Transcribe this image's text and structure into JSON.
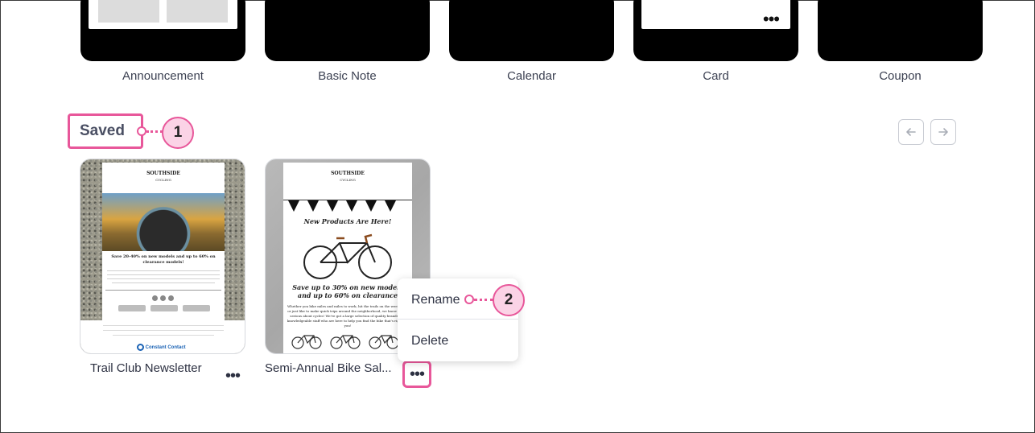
{
  "templates": [
    {
      "label": "Announcement"
    },
    {
      "label": "Basic Note"
    },
    {
      "label": "Calendar"
    },
    {
      "label": "Card"
    },
    {
      "label": "Coupon"
    }
  ],
  "saved_section": {
    "title": "Saved",
    "callout_1": "1",
    "prev_icon": "arrow-left-icon",
    "next_icon": "arrow-right-icon"
  },
  "saved_items": [
    {
      "name": "Trail Club Newsletter",
      "thumb": {
        "brand": "SOUTHSIDE",
        "brand_sub": "CYCLING",
        "headline": "Save 20-40% on new models and up to 60% on clearance models!",
        "logo": "Constant Contact"
      }
    },
    {
      "name": "Semi-Annual Bike Sal...",
      "thumb": {
        "brand": "SOUTHSIDE",
        "brand_sub": "CYCLING",
        "headline": "New Products Are Here!",
        "promo": "Save up to 30% on new models and up to 60% on clearance",
        "body": "Whether you bike miles and miles to work, hit the trails on the weekends, or just like to make quick trips around the neighborhood, we know you're serious about cycles! We've got a large selection of quality brands and knowledgeable staff who are here to help you find the bike that's right for you!"
      }
    }
  ],
  "more_glyph": "•••",
  "menu": {
    "rename": "Rename",
    "delete": "Delete",
    "callout_2": "2"
  },
  "colors": {
    "highlight": "#e8579a",
    "callout_fill": "#fbd3e6"
  }
}
